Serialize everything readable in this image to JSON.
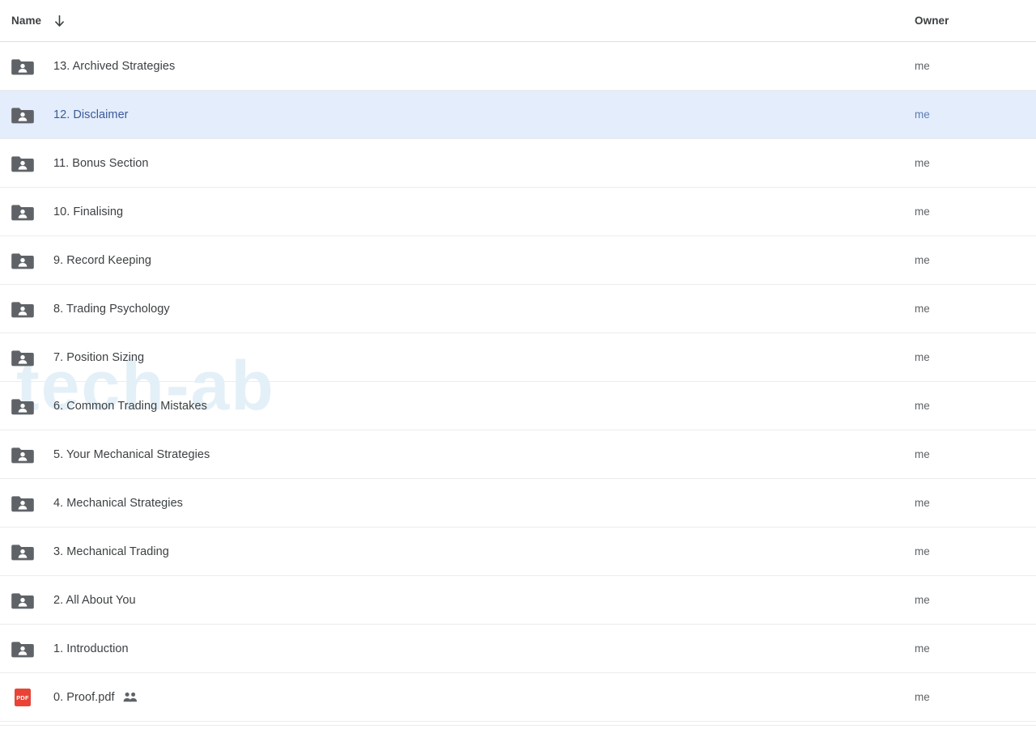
{
  "header": {
    "name_label": "Name",
    "owner_label": "Owner",
    "sort_icon": "arrow-down-icon",
    "sort_direction": "descending"
  },
  "watermark": {
    "text": "tech-ab"
  },
  "colors": {
    "selection_bg": "#e3edfb",
    "selection_text": "#3c5a9a",
    "text": "#3c4043",
    "secondary_text": "#5f6368",
    "row_divider": "#ececec",
    "folder_icon": "#5f6368",
    "pdf_icon": "#ea4335"
  },
  "rows": [
    {
      "name": "13. Archived Strategies",
      "owner": "me",
      "icon": "shared-folder-icon",
      "selected": false,
      "shared_badge": false
    },
    {
      "name": "12. Disclaimer",
      "owner": "me",
      "icon": "shared-folder-icon",
      "selected": true,
      "shared_badge": false
    },
    {
      "name": "11. Bonus Section",
      "owner": "me",
      "icon": "shared-folder-icon",
      "selected": false,
      "shared_badge": false
    },
    {
      "name": "10. Finalising",
      "owner": "me",
      "icon": "shared-folder-icon",
      "selected": false,
      "shared_badge": false
    },
    {
      "name": "9. Record Keeping",
      "owner": "me",
      "icon": "shared-folder-icon",
      "selected": false,
      "shared_badge": false
    },
    {
      "name": "8. Trading Psychology",
      "owner": "me",
      "icon": "shared-folder-icon",
      "selected": false,
      "shared_badge": false
    },
    {
      "name": "7. Position Sizing",
      "owner": "me",
      "icon": "shared-folder-icon",
      "selected": false,
      "shared_badge": false
    },
    {
      "name": "6. Common Trading Mistakes",
      "owner": "me",
      "icon": "shared-folder-icon",
      "selected": false,
      "shared_badge": false
    },
    {
      "name": "5. Your Mechanical Strategies",
      "owner": "me",
      "icon": "shared-folder-icon",
      "selected": false,
      "shared_badge": false
    },
    {
      "name": "4. Mechanical Strategies",
      "owner": "me",
      "icon": "shared-folder-icon",
      "selected": false,
      "shared_badge": false
    },
    {
      "name": "3. Mechanical Trading",
      "owner": "me",
      "icon": "shared-folder-icon",
      "selected": false,
      "shared_badge": false
    },
    {
      "name": "2. All About You",
      "owner": "me",
      "icon": "shared-folder-icon",
      "selected": false,
      "shared_badge": false
    },
    {
      "name": "1. Introduction",
      "owner": "me",
      "icon": "shared-folder-icon",
      "selected": false,
      "shared_badge": false
    },
    {
      "name": "0. Proof.pdf",
      "owner": "me",
      "icon": "pdf-file-icon",
      "selected": false,
      "shared_badge": true,
      "pdf_label": "PDF"
    }
  ]
}
